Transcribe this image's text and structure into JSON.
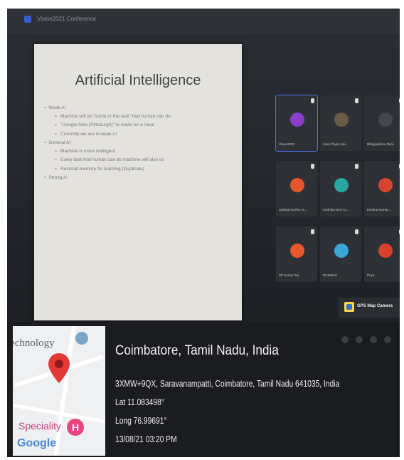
{
  "meeting": {
    "window_title": "Vision2021 Conference",
    "slide": {
      "title": "Artificial Intelligence",
      "bullets": [
        {
          "level": 1,
          "text": "Weak AI"
        },
        {
          "level": 2,
          "text": "Machine will do \"some or the task\" that human can do"
        },
        {
          "level": 2,
          "text": "\"Google Now (Pittsburgh)\" to roads for a meal"
        },
        {
          "level": 2,
          "text": "Currently we are in weak AI"
        },
        {
          "level": 1,
          "text": "General AI"
        },
        {
          "level": 2,
          "text": "Machine is more intelligent"
        },
        {
          "level": 2,
          "text": "Every task that human can do machine will also do"
        },
        {
          "level": 2,
          "text": "Reinstall memory for learning (Duplicate)"
        },
        {
          "level": 1,
          "text": "Strong AI"
        }
      ]
    },
    "participants": [
      {
        "name": "Vision2021",
        "avatar_color": "#8a3fc9",
        "active": true
      },
      {
        "name": "Jana Priyan Sai...",
        "avatar_color": "#6b5a44",
        "active": false
      },
      {
        "name": "Bhagyashree Rani...",
        "avatar_color": "#44484d",
        "active": false
      },
      {
        "name": "Sathyamoorthy AL...",
        "avatar_color": "#e5562a",
        "active": false
      },
      {
        "name": "Karthika Devi AL...",
        "avatar_color": "#2aa6a0",
        "active": false
      },
      {
        "name": "Krishna Kumar...",
        "avatar_color": "#d8432f",
        "active": false
      },
      {
        "name": "SP Kumar Sai",
        "avatar_color": "#e9582c",
        "active": false
      },
      {
        "name": "RCarthick",
        "avatar_color": "#3aa6d8",
        "active": false
      },
      {
        "name": "Priya",
        "avatar_color": "#d94129",
        "active": false
      }
    ]
  },
  "gps_badge": {
    "label": "GPS Map Camera"
  },
  "location": {
    "place": "Coimbatore, Tamil Nadu, India",
    "address": "3XMW+9QX, Saravanampatti, Coimbatore, Tamil Nadu 641035, India",
    "lat": "Lat 11.083498°",
    "long": "Long 76.99691°",
    "datetime": "13/08/21 03:20 PM"
  },
  "map": {
    "label_top": "Technology",
    "label_bottom": "Speciality",
    "attribution": "Google",
    "h_badge": "H"
  },
  "colors": {
    "accent": "#4a6fe3",
    "pin": "#e53935"
  }
}
